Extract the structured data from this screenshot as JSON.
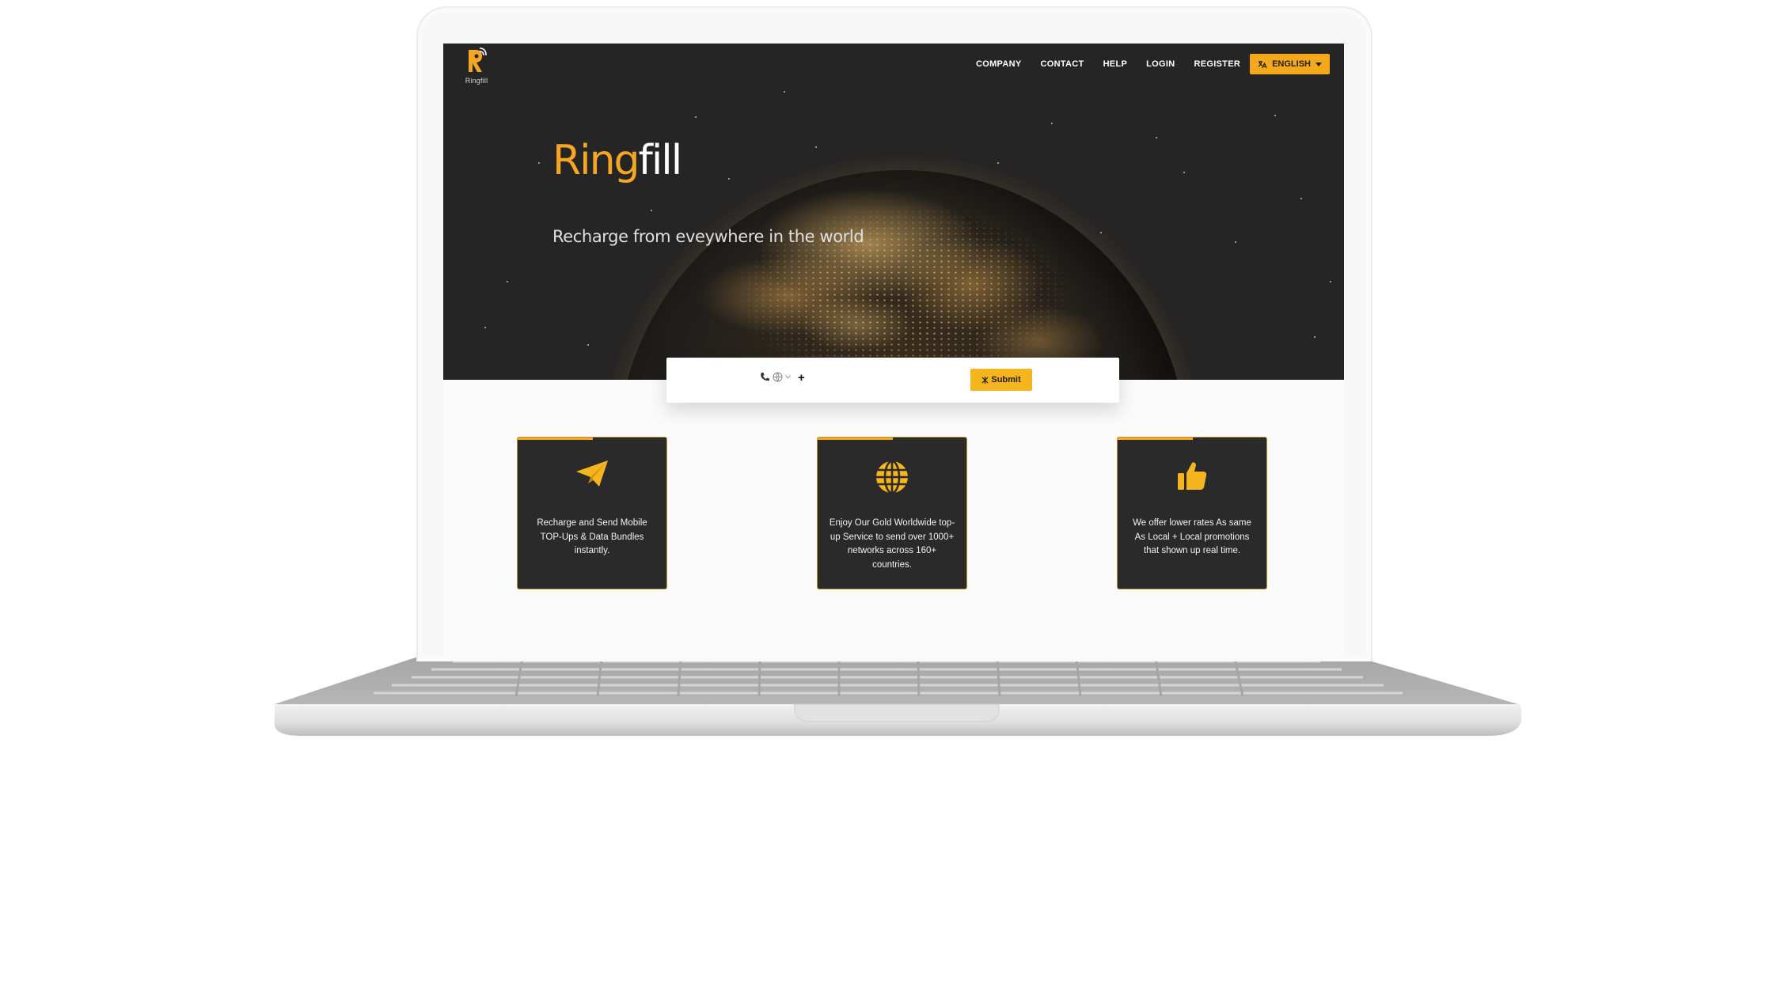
{
  "logo": {
    "text": "Ringfill"
  },
  "nav": {
    "items": [
      "COMPANY",
      "CONTACT",
      "HELP",
      "LOGIN",
      "REGISTER"
    ],
    "language": "ENGLISH"
  },
  "hero": {
    "brand_primary": "Ring",
    "brand_secondary": "fill",
    "tagline": "Recharge from eveywhere in the world"
  },
  "search": {
    "prefix": "+",
    "submit_label": "Submit"
  },
  "features": [
    {
      "icon": "paper-plane-icon",
      "text": "Recharge and Send Mobile TOP-Ups & Data Bundles instantly."
    },
    {
      "icon": "globe-icon",
      "text": "Enjoy Our Gold Worldwide top-up Service to send over 1000+ networks across 160+ countries."
    },
    {
      "icon": "thumbs-up-icon",
      "text": "We offer lower rates As same As Local + Local promotions that shown up real time."
    }
  ],
  "colors": {
    "accent": "#f5a623",
    "hero_background": "#262525",
    "card_background": "#2b2a2a",
    "button": "#f5b51f"
  }
}
